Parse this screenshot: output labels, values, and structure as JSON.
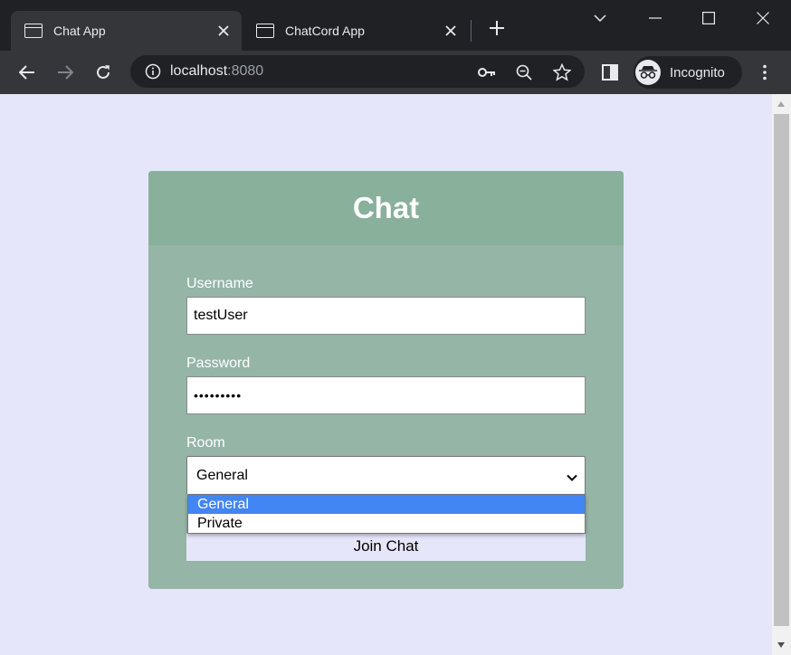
{
  "tabs": [
    {
      "title": "Chat App",
      "active": true
    },
    {
      "title": "ChatCord App",
      "active": false
    }
  ],
  "address_bar": {
    "host": "localhost",
    "port": ":8080"
  },
  "profile": {
    "label": "Incognito"
  },
  "form": {
    "title": "Chat",
    "username_label": "Username",
    "username_value": "testUser",
    "password_label": "Password",
    "password_value": "•••••••••",
    "room_label": "Room",
    "room_selected": "General",
    "room_options": [
      "General",
      "Private"
    ],
    "submit_label": "Join Chat"
  },
  "colors": {
    "page_bg": "#e6e6fa",
    "card_bg": "#95b5a6",
    "card_header_bg": "#88b09b",
    "selected_option": "#4285f4"
  }
}
